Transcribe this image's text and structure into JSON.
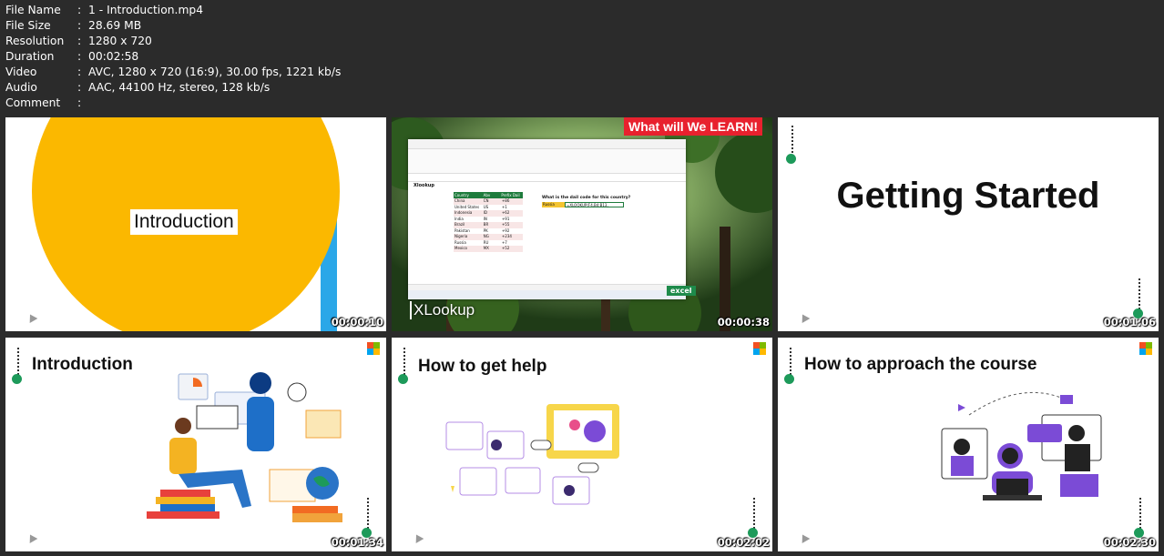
{
  "metadata": [
    {
      "label": "File Name",
      "value": "1 - Introduction.mp4"
    },
    {
      "label": "File Size",
      "value": "28.69 MB"
    },
    {
      "label": "Resolution",
      "value": "1280 x 720"
    },
    {
      "label": "Duration",
      "value": "00:02:58"
    },
    {
      "label": "Video",
      "value": "AVC, 1280 x 720 (16:9), 30.00 fps, 1221 kb/s"
    },
    {
      "label": "Audio",
      "value": "AAC, 44100 Hz, stereo, 128 kb/s"
    },
    {
      "label": "Comment",
      "value": ""
    }
  ],
  "thumbnails": [
    {
      "timestamp": "00:00:10",
      "title": "Introduction"
    },
    {
      "timestamp": "00:00:38",
      "banner": "What will We LEARN!",
      "caption": "XLookup",
      "tag": "excel",
      "sheet": {
        "title": "Xlookup",
        "question": "What is the dail code for this country?",
        "lookup_value": "Russia",
        "formula": "=XLOOKUP(F4,B4:B13,",
        "headers": [
          "Country",
          "Abv",
          "Prefix Dail"
        ],
        "rows": [
          [
            "China",
            "CN",
            "+86"
          ],
          [
            "United States",
            "US",
            "+1"
          ],
          [
            "Indonesia",
            "ID",
            "+62"
          ],
          [
            "India",
            "IN",
            "+91"
          ],
          [
            "Brazil",
            "BR",
            "+55"
          ],
          [
            "Pakistan",
            "PK",
            "+92"
          ],
          [
            "Nigeria",
            "NG",
            "+234"
          ],
          [
            "Russia",
            "RU",
            "+7"
          ],
          [
            "Mexico",
            "MX",
            "+52"
          ]
        ]
      }
    },
    {
      "timestamp": "00:01:06",
      "title": "Getting Started"
    },
    {
      "timestamp": "00:01:34",
      "title": "Introduction"
    },
    {
      "timestamp": "00:02:02",
      "title": "How to get help"
    },
    {
      "timestamp": "00:02:30",
      "title": "How to approach the course"
    }
  ],
  "colors": {
    "accent_green": "#1d9a5a",
    "intro_yellow": "#fbb800",
    "banner_red": "#e8212e",
    "excel_green": "#217346"
  }
}
